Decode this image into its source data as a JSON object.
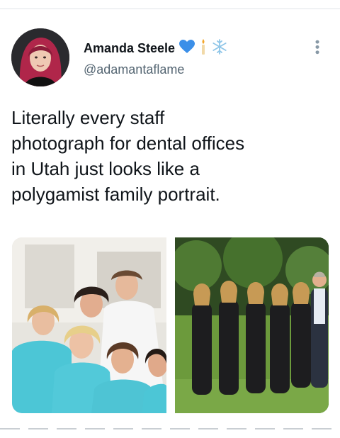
{
  "tweet": {
    "display_name": "Amanda Steele",
    "handle": "@adamantaflame",
    "text": "Literally every staff\nphotograph for dental offices\nin Utah just looks like a\npolygamist family portrait.",
    "name_badges": [
      "blue-heart-icon",
      "candle-icon",
      "snowflake-icon"
    ],
    "more_icon": "more-dots-icon"
  },
  "media": {
    "photos": [
      "dental-staff-photo-indoor",
      "dental-staff-photo-outdoor"
    ]
  },
  "colors": {
    "text": "#0f1419",
    "secondary": "#536471",
    "heart": "#3b8fe8",
    "scrubs_teal": "#4cc6d6",
    "scrubs_black": "#1d1d1f"
  }
}
